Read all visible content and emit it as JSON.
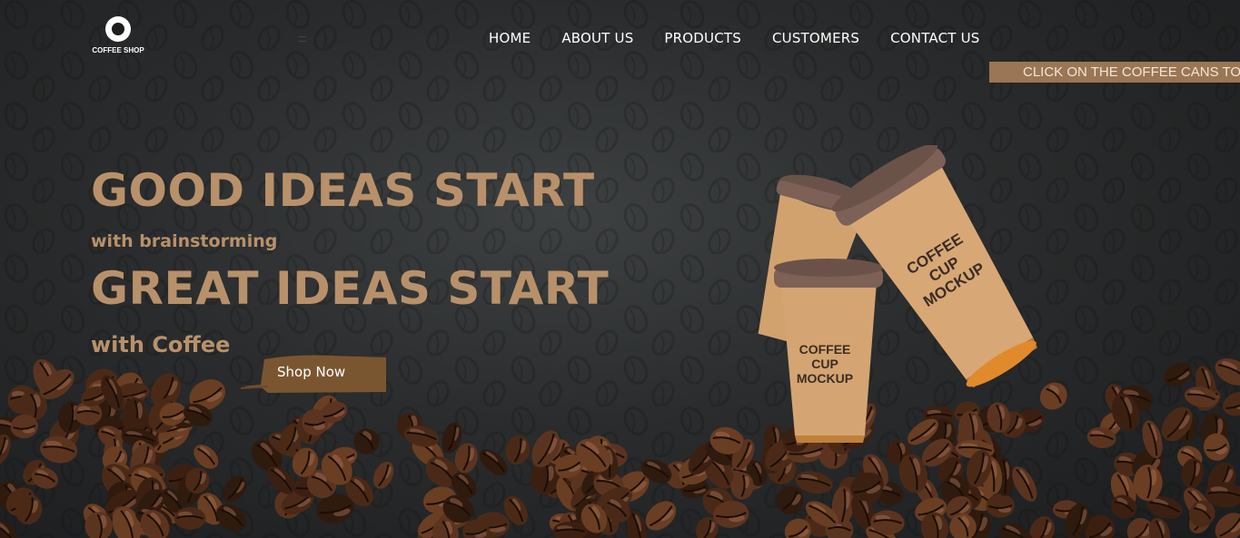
{
  "brand": {
    "logo_text": "COFFEE SHOP"
  },
  "nav": {
    "items": [
      {
        "label": "HOME"
      },
      {
        "label": "ABOUT US"
      },
      {
        "label": "PRODUCTS"
      },
      {
        "label": "CUSTOMERS"
      },
      {
        "label": "CONTACT US"
      }
    ]
  },
  "ticker": {
    "text": "CLICK ON THE COFFEE CANS TO"
  },
  "hero": {
    "headline_1": "GOOD IDEAS START",
    "subline_1": "with brainstorming",
    "headline_2": "GREAT IDEAS START",
    "subline_2": "with Coffee",
    "cta_label": "Shop Now"
  },
  "product_image": {
    "cup_label": "COFFEE CUP MOCKUP"
  },
  "colors": {
    "accent": "#b8916a",
    "ticker_bg": "#9a7654",
    "background": "#2a2c2d",
    "cta_brush": "#7a5630"
  },
  "icons": {
    "logo": "coffee-bean-icon",
    "menu": "hamburger-menu-icon"
  }
}
